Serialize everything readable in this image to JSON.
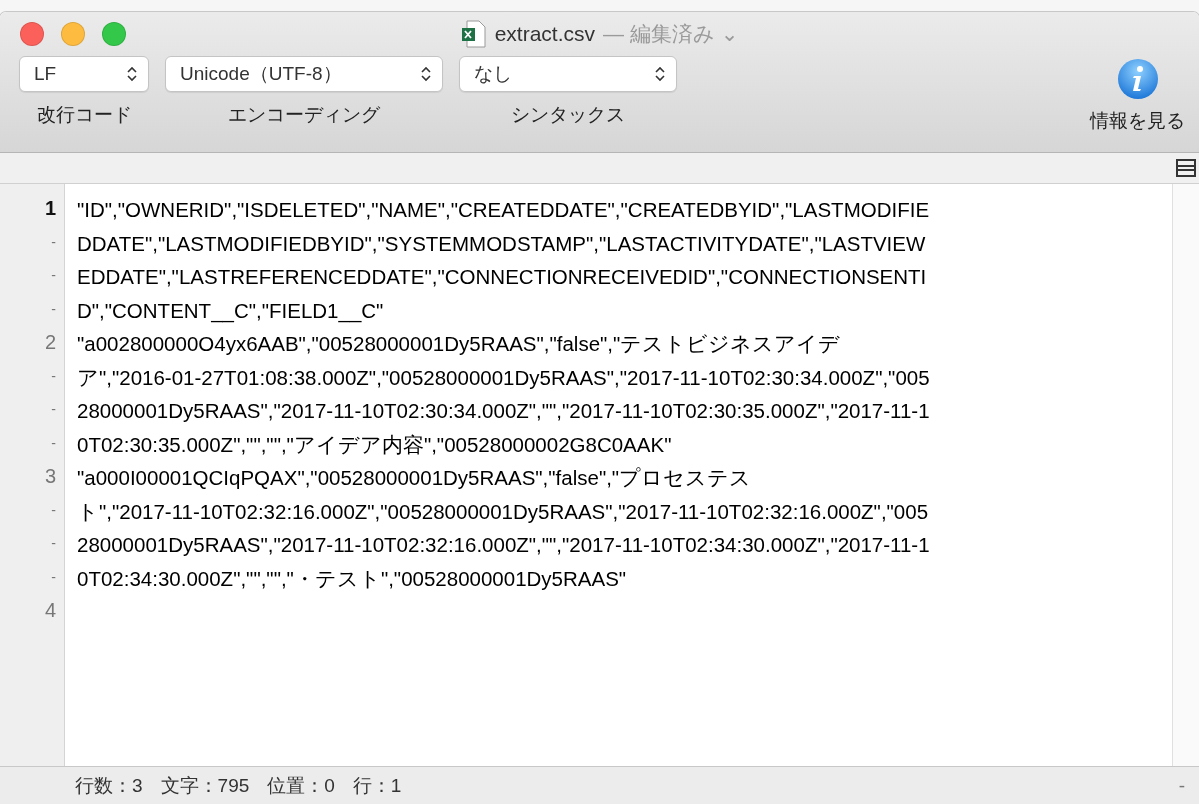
{
  "window": {
    "title": "extract.csv",
    "title_suffix": "— 編集済み ⌄"
  },
  "toolbar": {
    "popups": [
      {
        "value": "LF",
        "label": "改行コード"
      },
      {
        "value": "Unicode（UTF-8）",
        "label": "エンコーディング"
      },
      {
        "value": "なし",
        "label": "シンタックス"
      }
    ],
    "info_button": {
      "label": "情報を見る"
    }
  },
  "editor": {
    "lines": [
      {
        "gutter": "1",
        "current": true,
        "text": "\"ID\",\"OWNERID\",\"ISDELETED\",\"NAME\",\"CREATEDDATE\",\"CREATEDBYID\",\"LASTMODIFIE"
      },
      {
        "gutter": "-",
        "current": false,
        "text": "DDATE\",\"LASTMODIFIEDBYID\",\"SYSTEMMODSTAMP\",\"LASTACTIVITYDATE\",\"LASTVIEW"
      },
      {
        "gutter": "-",
        "current": false,
        "text": "EDDATE\",\"LASTREFERENCEDDATE\",\"CONNECTIONRECEIVEDID\",\"CONNECTIONSENTI"
      },
      {
        "gutter": "-",
        "current": false,
        "text": "D\",\"CONTENT__C\",\"FIELD1__C\""
      },
      {
        "gutter": "2",
        "current": false,
        "text": "\"a002800000O4yx6AAB\",\"00528000001Dy5RAAS\",\"false\",\"テストビジネスアイデ"
      },
      {
        "gutter": "-",
        "current": false,
        "text": "ア\",\"2016-01-27T01:08:38.000Z\",\"00528000001Dy5RAAS\",\"2017-11-10T02:30:34.000Z\",\"005"
      },
      {
        "gutter": "-",
        "current": false,
        "text": "28000001Dy5RAAS\",\"2017-11-10T02:30:34.000Z\",\"\",\"2017-11-10T02:30:35.000Z\",\"2017-11-1"
      },
      {
        "gutter": "-",
        "current": false,
        "text": "0T02:30:35.000Z\",\"\",\"\",\"アイデア内容\",\"00528000002G8C0AAK\""
      },
      {
        "gutter": "3",
        "current": false,
        "text": "\"a000I00001QCIqPQAX\",\"00528000001Dy5RAAS\",\"false\",\"プロセステス"
      },
      {
        "gutter": "-",
        "current": false,
        "text": "ト\",\"2017-11-10T02:32:16.000Z\",\"00528000001Dy5RAAS\",\"2017-11-10T02:32:16.000Z\",\"005"
      },
      {
        "gutter": "-",
        "current": false,
        "text": "28000001Dy5RAAS\",\"2017-11-10T02:32:16.000Z\",\"\",\"2017-11-10T02:34:30.000Z\",\"2017-11-1"
      },
      {
        "gutter": "-",
        "current": false,
        "text": "0T02:34:30.000Z\",\"\",\"\",\"・テスト\",\"00528000001Dy5RAAS\""
      },
      {
        "gutter": "4",
        "current": false
      }
    ]
  },
  "status_bar": {
    "items": [
      "行数：3",
      "文字：795",
      "位置：0",
      "行：1"
    ],
    "right": "-"
  }
}
